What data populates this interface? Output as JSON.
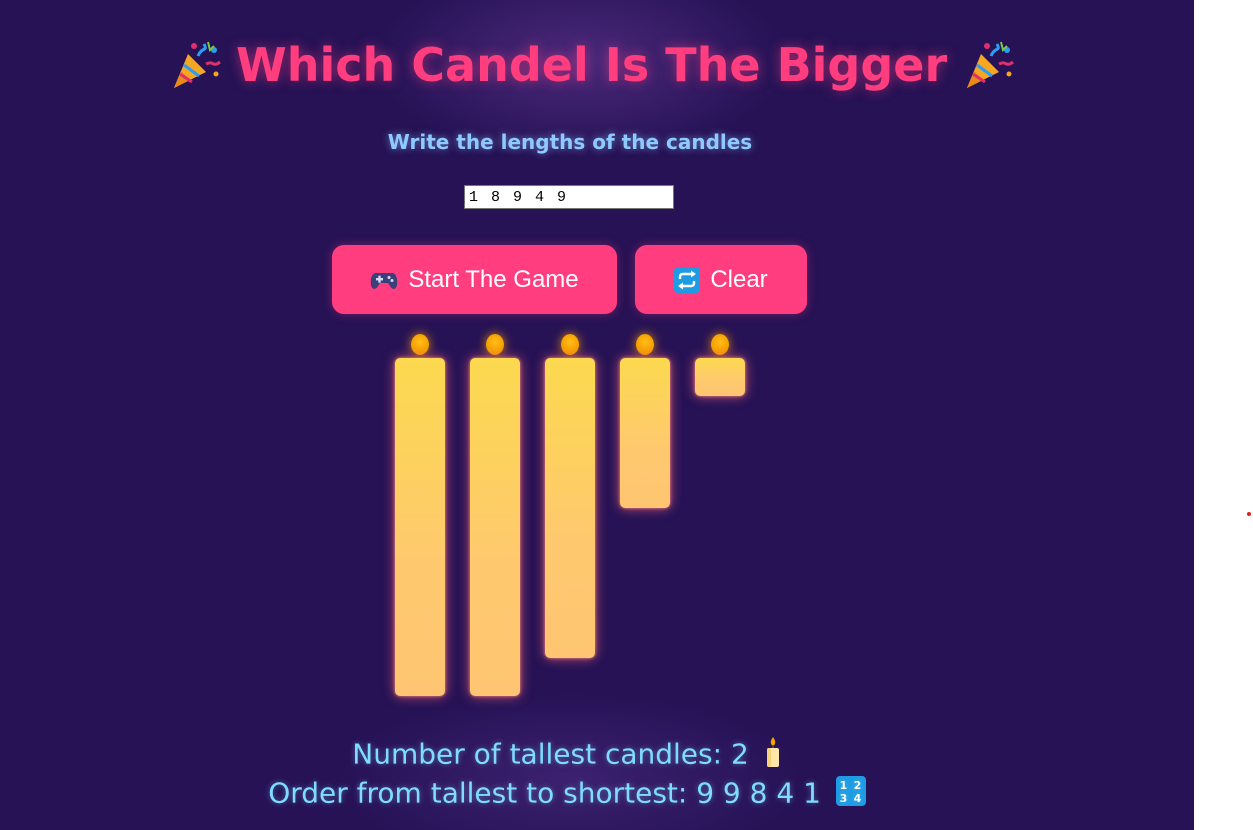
{
  "header": {
    "title": "Which Candel Is The Bigger",
    "left_icon": "party-popper-icon",
    "right_icon": "party-popper-icon",
    "title_color": "#ff3d7f"
  },
  "form": {
    "prompt": "Write the lengths of the candles",
    "input_value": "1 8 9 4 9"
  },
  "buttons": {
    "start_icon": "game-controller-icon",
    "start_label": "Start The Game",
    "clear_icon": "repeat-icon",
    "clear_label": "Clear",
    "color": "#ff3d7f"
  },
  "candles": {
    "lengths": [
      9,
      9,
      8,
      4,
      1
    ],
    "flame_color": "#f6a100",
    "body_color": "#fcd94f"
  },
  "results": {
    "tallest_count_label": "Number of tallest candles: 2",
    "tallest_count_icon": "candle-icon",
    "order_label": "Order from tallest to shortest: 9 9 8 4 1",
    "order_icon": "input-numbers-icon"
  },
  "colors": {
    "background": "#261255",
    "subtitle": "#8ec9ff",
    "result_text": "#7fdcff"
  }
}
